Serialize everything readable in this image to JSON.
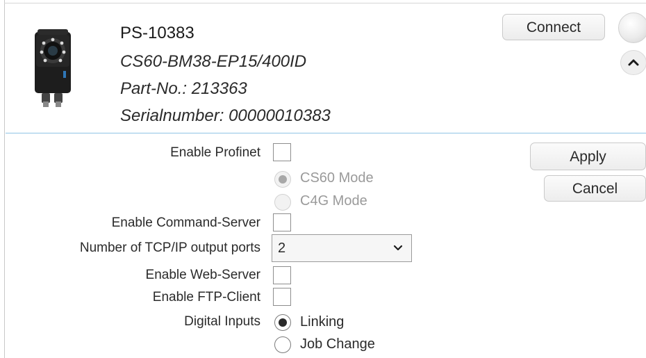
{
  "header": {
    "device_name": "PS-10383",
    "model": "CS60-BM38-EP15/400ID",
    "part_no": "Part-No.: 213363",
    "serial": "Serialnumber: 00000010383",
    "connect_label": "Connect"
  },
  "settings": {
    "enable_profinet_label": "Enable Profinet",
    "mode_options": [
      {
        "label": "CS60 Mode",
        "selected": true,
        "enabled": false
      },
      {
        "label": "C4G Mode",
        "selected": false,
        "enabled": false
      }
    ],
    "enable_command_server_label": "Enable Command-Server",
    "tcp_ports_label": "Number of TCP/IP output ports",
    "tcp_ports_value": "2",
    "enable_web_server_label": "Enable Web-Server",
    "enable_ftp_client_label": "Enable FTP-Client",
    "digital_inputs_label": "Digital Inputs",
    "digital_input_options": [
      {
        "label": "Linking",
        "selected": true
      },
      {
        "label": "Job Change",
        "selected": false
      }
    ]
  },
  "actions": {
    "apply_label": "Apply",
    "cancel_label": "Cancel"
  },
  "icons": {
    "device": "camera-sensor-icon",
    "collapse": "chevron-up-icon",
    "dropdown": "chevron-down-icon",
    "status": "status-indicator"
  }
}
